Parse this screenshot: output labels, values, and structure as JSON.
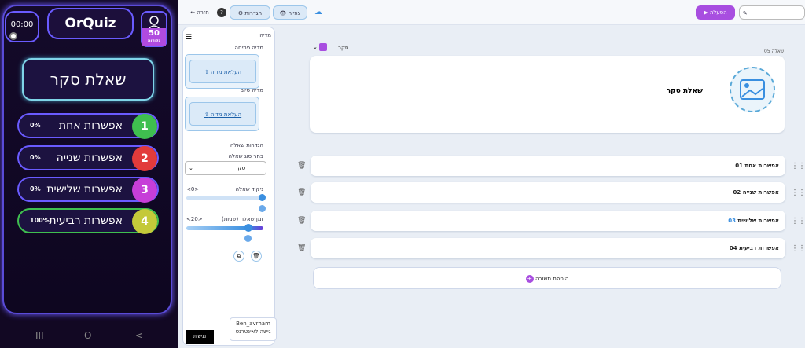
{
  "phone": {
    "timer": "00:00",
    "logo": "OrQuiz",
    "score": "50",
    "score_sub": "נקודות",
    "question": "שאלת סקר",
    "options": [
      {
        "num": "1",
        "label": "אפשרות אחת",
        "pct": "0%",
        "color": "#3fbf4f"
      },
      {
        "num": "2",
        "label": "אפשרות שנייה",
        "pct": "0%",
        "color": "#e23b3b"
      },
      {
        "num": "3",
        "label": "אפשרות שלישית",
        "pct": "0%",
        "color": "#c63ed8"
      },
      {
        "num": "4",
        "label": "אפשרות רביעית",
        "pct": "100%",
        "color": "#c4c93a"
      }
    ],
    "nav": {
      "recent": "III",
      "home": "O",
      "back": "<"
    }
  },
  "toolbar": {
    "back": "חזרה",
    "settings": "הגדרות",
    "preview": "צפייה",
    "run": "הפעלה"
  },
  "sidebar": {
    "media_title": "מדיה",
    "opening_media": "מדיה פתיחה",
    "upload": "העלאת מדיה",
    "closing_media": "מדיה סיום",
    "question_settings": "הגדרות שאלה",
    "choose_type": "בחר סוג שאלה",
    "type_value": "סקר",
    "score_label": "ניקוד שאלה",
    "score_value": "0",
    "time_label": "זמן שאלה (שניות)",
    "time_value": "20"
  },
  "main": {
    "type_selector": "סקר",
    "question_num": "שאלה 05",
    "question_text": "שאלת סקר",
    "answers": [
      {
        "num": "01",
        "label": "אפשרות אחת"
      },
      {
        "num": "02",
        "label": "אפשרות שנייה"
      },
      {
        "num": "03",
        "label": "אפשרות שלישית"
      },
      {
        "num": "04",
        "label": "אפשרות רביעית"
      }
    ],
    "add_answer": "הוספת תשובה"
  },
  "footer": {
    "badge": "נגישות",
    "user": "Ben_avrham",
    "user_sub": "גישה לאינטרנט"
  }
}
